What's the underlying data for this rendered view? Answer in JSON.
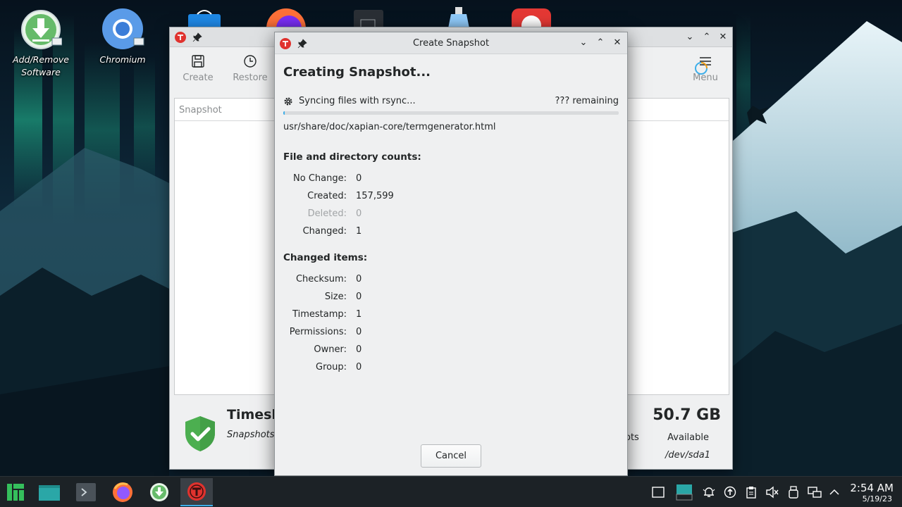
{
  "desktop": {
    "icons": [
      {
        "label_line1": "Add/Remove",
        "label_line2": "Software"
      },
      {
        "label_line1": "Chromium",
        "label_line2": ""
      }
    ]
  },
  "background_window": {
    "toolbar": {
      "create_label": "Create",
      "restore_label": "Restore",
      "menu_label": "Menu"
    },
    "table": {
      "column_snapshot": "Snapshot"
    },
    "status": {
      "title": "Timesh",
      "subtitle": "Snapshots",
      "snapshots_fragment": "ots",
      "size": "50.7 GB",
      "available": "Available",
      "device": "/dev/sda1"
    }
  },
  "dialog": {
    "title": "Create Snapshot",
    "heading": "Creating Snapshot...",
    "sync_status": "Syncing files with rsync...",
    "remaining": "??? remaining",
    "progress": 0.005,
    "current_file": "usr/share/doc/xapian-core/termgenerator.html",
    "counts_section": {
      "title": "File and directory counts:",
      "rows": [
        {
          "label": "No Change:",
          "value": "0"
        },
        {
          "label": "Created:",
          "value": "157,599"
        },
        {
          "label": "Deleted:",
          "value": "0"
        },
        {
          "label": "Changed:",
          "value": "1"
        }
      ]
    },
    "changed_section": {
      "title": "Changed items:",
      "rows": [
        {
          "label": "Checksum:",
          "value": "0"
        },
        {
          "label": "Size:",
          "value": "0"
        },
        {
          "label": "Timestamp:",
          "value": "1"
        },
        {
          "label": "Permissions:",
          "value": "0"
        },
        {
          "label": "Owner:",
          "value": "0"
        },
        {
          "label": "Group:",
          "value": "0"
        }
      ]
    },
    "cancel_label": "Cancel"
  },
  "taskbar": {
    "clock_time": "2:54 AM",
    "clock_date": "5/19/23"
  },
  "colors": {
    "accent": "#3daee9",
    "timeshift_red": "#e0322e",
    "shield_green": "#4caf50"
  }
}
